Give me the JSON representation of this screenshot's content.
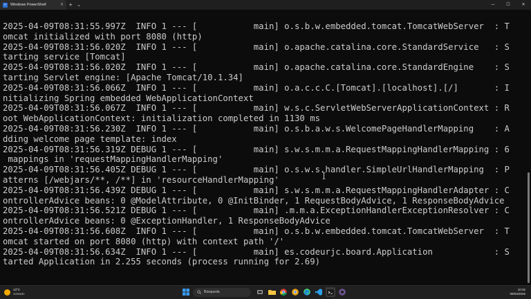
{
  "window": {
    "tab_title": "Windows PowerShell",
    "new_tab": "+",
    "dropdown": "⌄",
    "close_tab": "×",
    "minimize": "—",
    "maximize": "☐",
    "close": "✕"
  },
  "terminal": {
    "lines": [
      "2025-04-09T08:31:55.997Z  INFO 1 --- [           main] o.s.b.w.embedded.tomcat.TomcatWebServer  : T",
      "omcat initialized with port 8080 (http)",
      "2025-04-09T08:31:56.020Z  INFO 1 --- [           main] o.apache.catalina.core.StandardService   : S",
      "tarting service [Tomcat]",
      "2025-04-09T08:31:56.020Z  INFO 1 --- [           main] o.apache.catalina.core.StandardEngine    : S",
      "tarting Servlet engine: [Apache Tomcat/10.1.34]",
      "2025-04-09T08:31:56.066Z  INFO 1 --- [           main] o.a.c.c.C.[Tomcat].[localhost].[/]       : I",
      "nitializing Spring embedded WebApplicationContext",
      "2025-04-09T08:31:56.067Z  INFO 1 --- [           main] w.s.c.ServletWebServerApplicationContext : R",
      "oot WebApplicationContext: initialization completed in 1130 ms",
      "2025-04-09T08:31:56.230Z  INFO 1 --- [           main] o.s.b.a.w.s.WelcomePageHandlerMapping    : A",
      "dding welcome page template: index",
      "2025-04-09T08:31:56.319Z DEBUG 1 --- [           main] s.w.s.m.m.a.RequestMappingHandlerMapping : 6",
      " mappings in 'requestMappingHandlerMapping'",
      "2025-04-09T08:31:56.405Z DEBUG 1 --- [           main] o.s.w.s.handler.SimpleUrlHandlerMapping  : P",
      "atterns [/webjars/**, /**] in 'resourceHandlerMapping'",
      "2025-04-09T08:31:56.439Z DEBUG 1 --- [           main] s.w.s.m.m.a.RequestMappingHandlerAdapter : C",
      "ontrollerAdvice beans: 0 @ModelAttribute, 0 @InitBinder, 1 RequestBodyAdvice, 1 ResponseBodyAdvice",
      "2025-04-09T08:31:56.521Z DEBUG 1 --- [           main] .m.m.a.ExceptionHandlerExceptionResolver : C",
      "ontrollerAdvice beans: 0 @ExceptionHandler, 1 ResponseBodyAdvice",
      "2025-04-09T08:31:56.608Z  INFO 1 --- [           main] o.s.b.w.embedded.tomcat.TomcatWebServer  : T",
      "omcat started on port 8080 (http) with context path '/'",
      "2025-04-09T08:31:56.634Z  INFO 1 --- [           main] es.codeurjc.board.Application            : S",
      "tarted Application in 2.255 seconds (process running for 2.69)"
    ]
  },
  "taskbar": {
    "weather_temp": "13°C",
    "weather_condition": "Soleado",
    "search_placeholder": "Búsqueda",
    "clock_time": "10:32",
    "clock_date": "09/04/2025"
  },
  "colors": {
    "terminal_bg": "#0c0c0c",
    "terminal_fg": "#cccccc",
    "titlebar_bg": "#1f1f1f",
    "taskbar_bg": "#202020",
    "powershell_blue": "#2b6fd6"
  }
}
